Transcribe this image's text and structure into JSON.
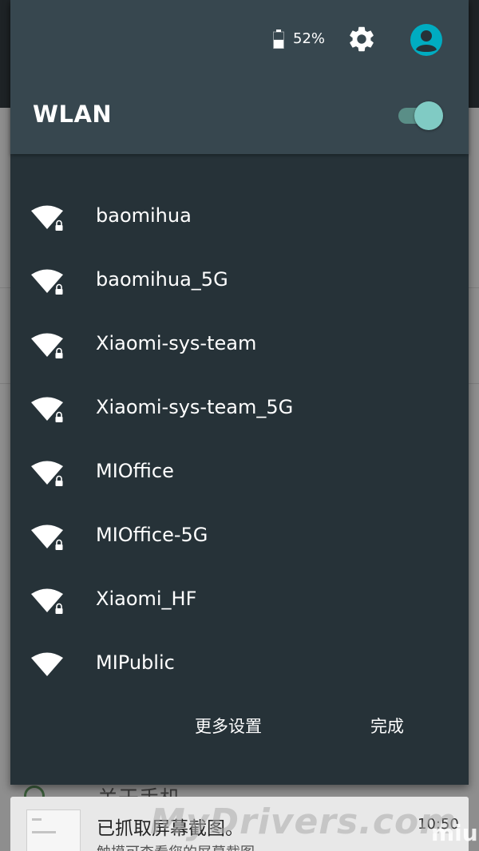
{
  "status": {
    "battery_percent_label": "52%",
    "battery_level": 0.52
  },
  "header": {
    "title": "WLAN",
    "wlan_enabled": true
  },
  "networks": [
    {
      "name": "baomihua",
      "secured": true
    },
    {
      "name": "baomihua_5G",
      "secured": true
    },
    {
      "name": "Xiaomi-sys-team",
      "secured": true
    },
    {
      "name": "Xiaomi-sys-team_5G",
      "secured": true
    },
    {
      "name": "MIOffice",
      "secured": true
    },
    {
      "name": "MIOffice-5G",
      "secured": true
    },
    {
      "name": "Xiaomi_HF",
      "secured": true
    },
    {
      "name": "MIPublic",
      "secured": false
    }
  ],
  "footer": {
    "more_settings_label": "更多设置",
    "done_label": "完成"
  },
  "background": {
    "about_phone_label": "关于手机"
  },
  "toast": {
    "title": "已抓取屏幕截图。",
    "subtitle": "触摸可查看您的屏幕截图",
    "time": "10:50"
  },
  "watermarks": {
    "site": "MyDrivers.com",
    "brand": "miui"
  },
  "colors": {
    "panel_bg": "#263238",
    "header_bg": "#37474f",
    "accent": "#80cbc4",
    "avatar": "#00acc1"
  },
  "icons": {
    "battery": "battery-icon",
    "settings": "gear-icon",
    "user": "avatar-icon",
    "wifi": "wifi-signal-icon",
    "lock": "lock-icon"
  }
}
